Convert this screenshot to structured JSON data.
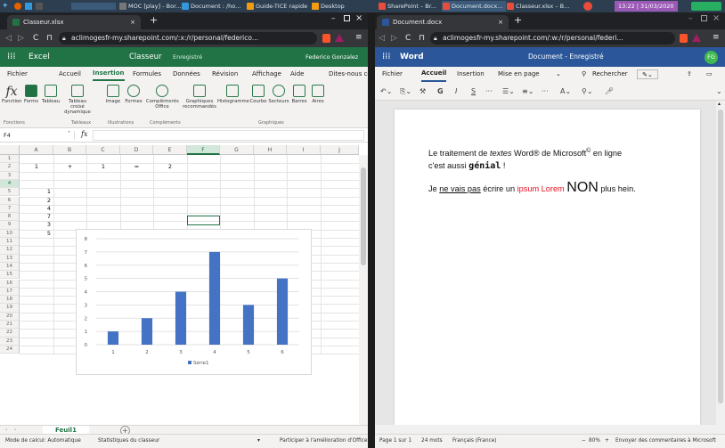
{
  "taskbar": {
    "items": [
      "MOC [play] - Bor...",
      "Document : /ho...",
      "Guide-TICE rapide",
      "Desktop",
      "SharePoint – Br...",
      "Document.docx...",
      "Classeur.xlsx – B..."
    ],
    "clock": "13:22 | 31/03/2020"
  },
  "excel_window": {
    "tab_title": "Classeur.xlsx",
    "new_tab": "+",
    "url": "aclimogesfr-my.sharepoint.com/:x:/r/personal/federico...",
    "app_name": "Excel",
    "doc_title": "Classeur",
    "save_status": "Enregistré",
    "user": "Federico Gonzalez",
    "menu": [
      "Fichier",
      "Accueil",
      "Insertion",
      "Formules",
      "Données",
      "Révision",
      "Affichage",
      "Aide",
      "Dites-nous ce"
    ],
    "ribbon": {
      "fonction_label": "Fonction",
      "forms": "Forms",
      "tableau": "Tableau",
      "tableau_croise": "Tableau croisé dynamique",
      "image": "Image",
      "formes": "Formes",
      "complements_office": "Compléments Office",
      "graphiques_recommandes": "Graphiques recommandés",
      "histogramme": "Histogramme",
      "courbe": "Courbe",
      "secteurs": "Secteurs",
      "barres": "Barres",
      "aires": "Aires",
      "groups": [
        "Fonctions",
        "Tableaux",
        "Illustrations",
        "Compléments",
        "Graphiques"
      ]
    },
    "name_box": "F4",
    "fx": "fx",
    "columns": [
      "A",
      "B",
      "C",
      "D",
      "E",
      "F",
      "G",
      "H",
      "I",
      "J"
    ],
    "rows": [
      "1",
      "2",
      "3",
      "4",
      "5",
      "6",
      "7",
      "8",
      "9",
      "10",
      "11",
      "12",
      "13",
      "14",
      "15",
      "16",
      "17",
      "18",
      "19",
      "20",
      "21",
      "22",
      "23",
      "24"
    ],
    "cells": {
      "A2": "1",
      "B2": "+",
      "C2": "1",
      "D2": "=",
      "E2": "2",
      "A5": "1",
      "A6": "2",
      "A7": "4",
      "A8": "7",
      "A9": "3",
      "A10": "5"
    },
    "sheet_tab": "Feuil1",
    "add_sheet": "+",
    "status": {
      "mode": "Mode de calcul: Automatique",
      "stats": "Statistiques du classeur",
      "feedback": "Participer à l'amélioration d'Office"
    }
  },
  "chart_data": {
    "type": "bar",
    "categories": [
      "1",
      "2",
      "3",
      "4",
      "5",
      "6"
    ],
    "series": [
      {
        "name": "Série1",
        "values": [
          1,
          2,
          4,
          7,
          3,
          5
        ]
      }
    ],
    "ylim": [
      0,
      8
    ],
    "yticks": [
      "0",
      "1",
      "2",
      "3",
      "4",
      "5",
      "6",
      "7",
      "8"
    ],
    "grid": true,
    "legend": "bottom",
    "color": "#4472c4"
  },
  "word_window": {
    "tab_title": "Document.docx",
    "new_tab": "+",
    "url": "aclimogesfr-my.sharepoint.com/:w:/r/personal/federi...",
    "app_name": "Word",
    "doc_title": "Document - Enregistré",
    "user_initials": "FG",
    "menu": [
      "Fichier",
      "Accueil",
      "Insertion",
      "Mise en page",
      "Rechercher"
    ],
    "doc": {
      "p1_a": "Le traitement de ",
      "p1_italic": "textes",
      "p1_b": " Word® de Microsoft",
      "p1_sup": "©",
      "p1_c": " en ligne",
      "p1_line2": "c'est aussi ",
      "p1_bold": "génial",
      "p1_end": " !",
      "p2_a": "Je ",
      "p2_underline": "ne vais pas",
      "p2_b": " écrire un ",
      "p2_red": "ipsum Lorem",
      "p2_c": " ",
      "p2_big": "NON",
      "p2_d": " plus hein."
    },
    "status": {
      "page": "Page 1 sur 1",
      "words": "24 mots",
      "lang": "Français (France)",
      "zoom": "80%",
      "feedback": "Envoyer des commentaires à Microsoft"
    }
  },
  "colors": {
    "excel": "#217346",
    "word": "#2b579a",
    "chrome": "#35363a",
    "red_text": "#e81123"
  }
}
